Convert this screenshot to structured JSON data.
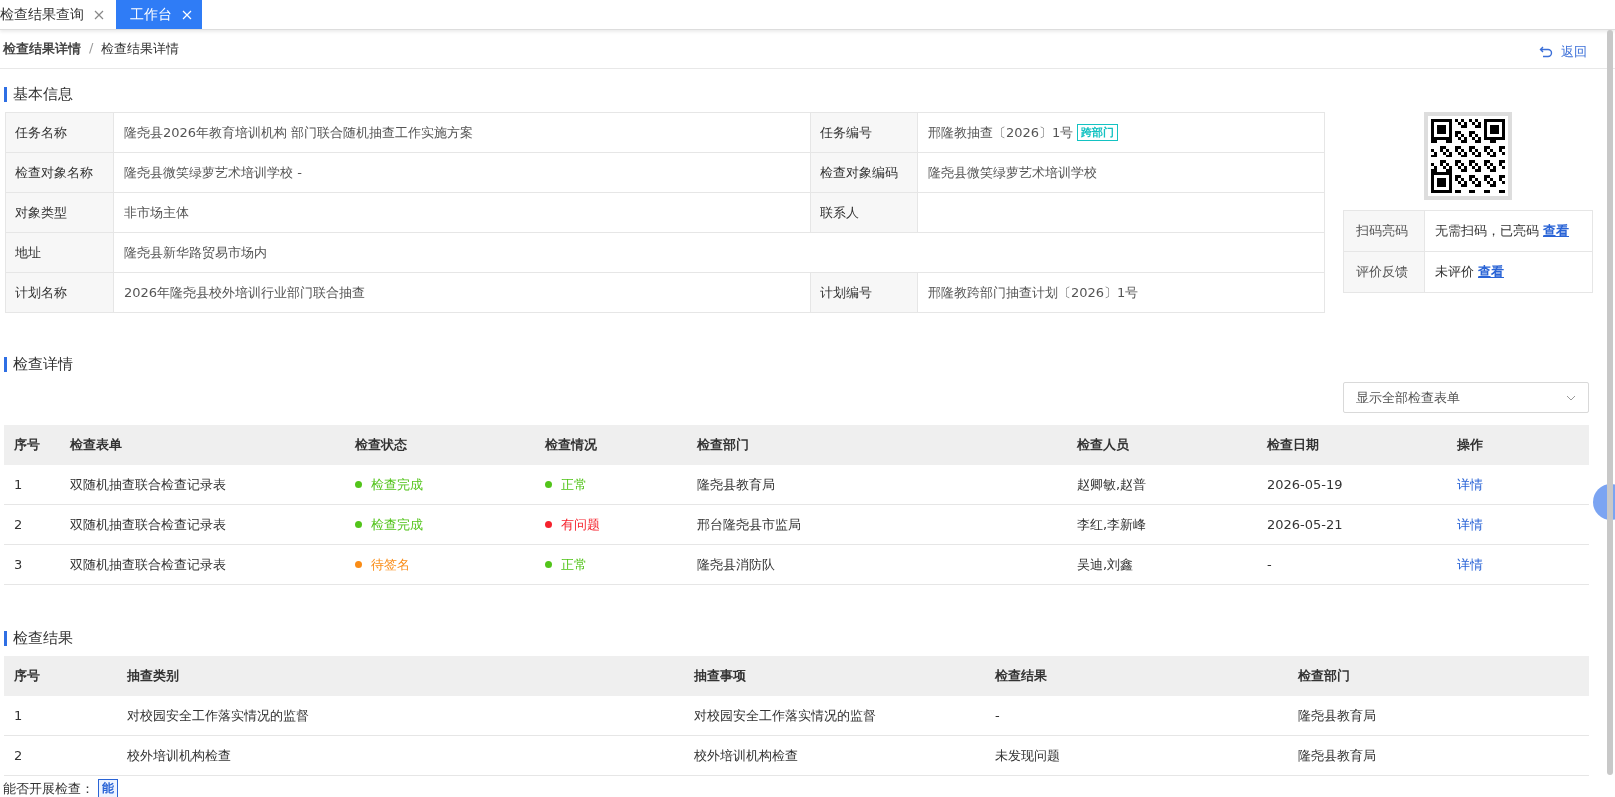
{
  "tabs": [
    {
      "label": "检查结果查询",
      "selected": false
    },
    {
      "label": "工作台",
      "selected": true
    }
  ],
  "breadcrumb": {
    "items": [
      "检查结果详情",
      "检查结果详情"
    ],
    "separator": "/"
  },
  "back_link": "返回",
  "basic_info": {
    "title": "基本信息",
    "rows": [
      {
        "cells": [
          {
            "label": "任务名称",
            "value": "隆尧县2026年教育培训机构 部门联合随机抽查工作实施方案"
          },
          {
            "label": "任务编号",
            "value": "邢隆教抽查〔2026〕1号",
            "tag": "跨部门"
          }
        ]
      },
      {
        "cells": [
          {
            "label": "检查对象名称",
            "value": "隆尧县微笑绿萝艺术培训学校  -"
          },
          {
            "label": "检查对象编码",
            "value": "隆尧县微笑绿萝艺术培训学校"
          }
        ]
      },
      {
        "cells": [
          {
            "label": "对象类型",
            "value": "非市场主体"
          },
          {
            "label": "联系人"
          }
        ]
      },
      {
        "cells": [
          {
            "label": "地址",
            "value": "隆尧县新华路贸易市场内"
          }
        ]
      },
      {
        "cells": [
          {
            "label": "计划名称",
            "value": "2026年隆尧县校外培训行业部门联合抽查"
          },
          {
            "label": "计划编号",
            "value": "邢隆教跨部门抽查计划〔2026〕1号"
          }
        ]
      }
    ],
    "side": [
      {
        "label": "扫码亮码",
        "value": "无需扫码，已亮码",
        "link": "查看"
      },
      {
        "label": "评价反馈",
        "value": "未评价",
        "link": "查看"
      }
    ]
  },
  "details": {
    "title": "检查详情",
    "filter": "显示全部检查表单",
    "columns": [
      "序号",
      "检查表单",
      "检查状态",
      "检查情况",
      "检查部门",
      "检查人员",
      "检查日期",
      "操作"
    ],
    "rows": [
      {
        "no": "1",
        "form": "双随机抽查联合检查记录表",
        "status": {
          "text": "检查完成",
          "color": "#52c41a"
        },
        "situation": {
          "text": "正常",
          "color": "#52c41a"
        },
        "dept": "隆尧县教育局",
        "staff": "赵卿敏,赵普",
        "date": "2026-05-19",
        "action": "详情"
      },
      {
        "no": "2",
        "form": "双随机抽查联合检查记录表",
        "status": {
          "text": "检查完成",
          "color": "#52c41a"
        },
        "situation": {
          "text": "有问题",
          "color": "#f5222d"
        },
        "dept": "邢台隆尧县市监局",
        "staff": "李红,李新峰",
        "date": "2026-05-21",
        "action": "详情"
      },
      {
        "no": "3",
        "form": "双随机抽查联合检查记录表",
        "status": {
          "text": "待签名",
          "color": "#fa8c16"
        },
        "situation": {
          "text": "正常",
          "color": "#52c41a"
        },
        "dept": "隆尧县消防队",
        "staff": "吴迪,刘鑫",
        "date": "-",
        "action": "详情"
      }
    ]
  },
  "results": {
    "title": "检查结果",
    "columns": [
      "序号",
      "抽查类别",
      "抽查事项",
      "检查结果",
      "检查部门"
    ],
    "rows": [
      [
        "1",
        "对校园安全工作落实情况的监督",
        "对校园安全工作落实情况的监督",
        "-",
        "隆尧县教育局"
      ],
      [
        "2",
        "校外培训机构检查",
        "校外培训机构检查",
        "未发现问题",
        "隆尧县教育局"
      ]
    ]
  },
  "footer": {
    "label": "能否开展检查：",
    "tag": "能"
  }
}
